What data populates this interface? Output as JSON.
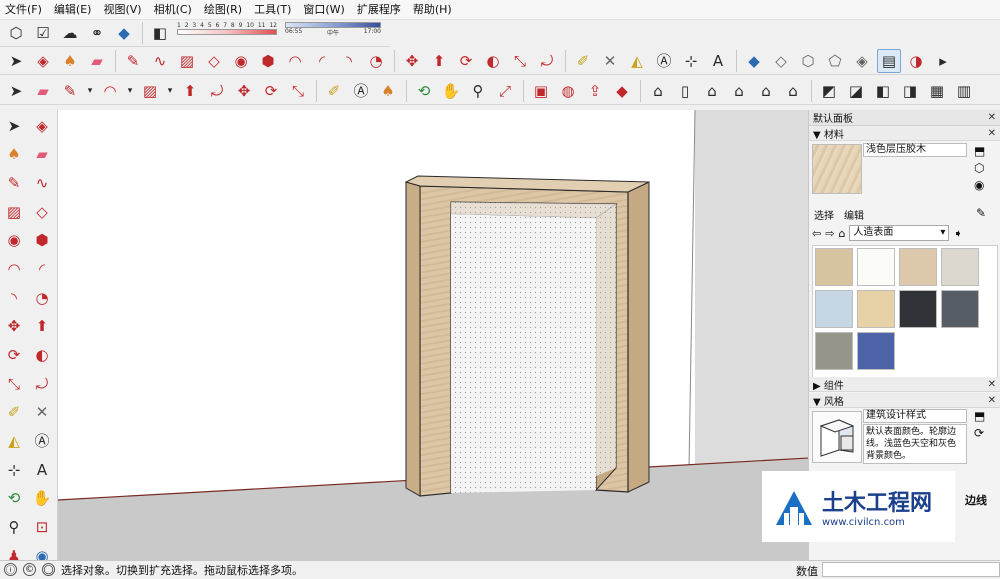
{
  "menubar": {
    "items": [
      "文件(F)",
      "编辑(E)",
      "视图(V)",
      "相机(C)",
      "绘图(R)",
      "工具(T)",
      "窗口(W)",
      "扩展程序",
      "帮助(H)"
    ]
  },
  "shadows": {
    "month_scale": [
      "1",
      "2",
      "3",
      "4",
      "5",
      "6",
      "7",
      "8",
      "9",
      "10",
      "11",
      "12"
    ],
    "time_start": "06:55",
    "time_mid": "中午",
    "time_end": "17:00"
  },
  "panel": {
    "title": "默认面板",
    "materials": {
      "label": "材料",
      "name": "浅色层压胶木",
      "tab_select": "选择",
      "tab_edit": "编辑",
      "library": "人造表面",
      "swatch_colors": [
        "#d8c3a1",
        "#fbfbf8",
        "#dec8ab",
        "#dcd8d0",
        "#c7d6e3",
        "#e7d1a7",
        "#2f3337",
        "#565d65",
        "#96958a",
        "#4c64a7"
      ]
    },
    "components": {
      "label": "组件"
    },
    "styles": {
      "label": "风格",
      "name": "建筑设计样式",
      "description": "默认表面颜色。轮廓边线。浅蓝色天空和灰色背景颜色。"
    }
  },
  "viewport": {
    "edge_label": "边线"
  },
  "watermark": {
    "title": "土木工程网",
    "url": "www.civilcn.com"
  },
  "statusbar": {
    "hint": "选择对象。切换到扩充选择。拖动鼠标选择多项。",
    "measurement_label": "数值"
  },
  "colors": {
    "accent": "#2b6cb0",
    "frame_front": "#dcc6a6",
    "frame_side": "#c6ab86",
    "panel_fill": "#f4f4f4"
  }
}
